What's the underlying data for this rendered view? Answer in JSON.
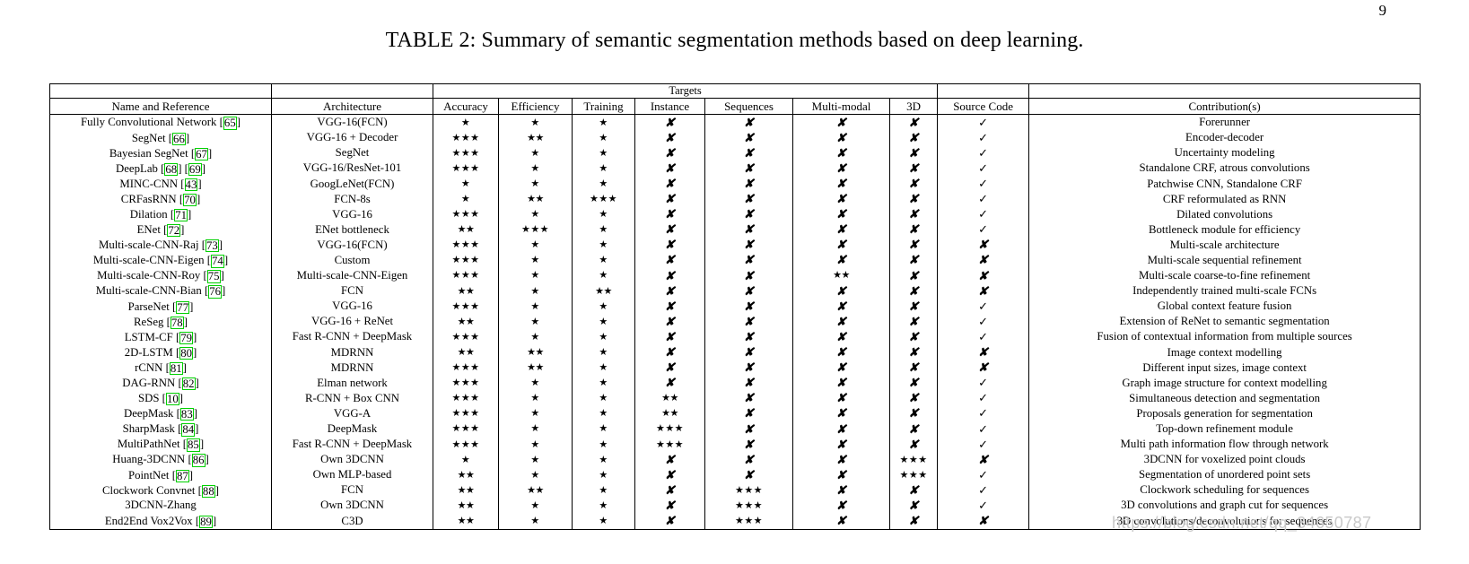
{
  "page": {
    "number": "9",
    "caption": "TABLE 2: Summary of semantic segmentation methods based on deep learning.",
    "watermark": "https://blog.csdn.net/qq_34650787"
  },
  "table": {
    "group_header": {
      "targets_label": "Targets"
    },
    "columns": [
      {
        "key": "name",
        "label": "Name and Reference"
      },
      {
        "key": "architecture",
        "label": "Architecture"
      },
      {
        "key": "accuracy",
        "label": "Accuracy"
      },
      {
        "key": "efficiency",
        "label": "Efficiency"
      },
      {
        "key": "training",
        "label": "Training"
      },
      {
        "key": "instance",
        "label": "Instance"
      },
      {
        "key": "sequences",
        "label": "Sequences"
      },
      {
        "key": "multimodal",
        "label": "Multi-modal"
      },
      {
        "key": "threed",
        "label": "3D"
      },
      {
        "key": "source_code",
        "label": "Source Code"
      },
      {
        "key": "contribution",
        "label": "Contribution(s)"
      }
    ],
    "marks": {
      "star": "★",
      "cross": "✘",
      "check": "✓",
      "ref_box_color": "#00d000"
    },
    "rows": [
      {
        "name": "Fully Convolutional Network",
        "refs": [
          "65"
        ],
        "architecture": "VGG-16(FCN)",
        "accuracy": 1,
        "efficiency": 1,
        "training": 1,
        "instance": "cross",
        "sequences": "cross",
        "multimodal": "cross",
        "threed": "cross",
        "source_code": "check",
        "contribution": "Forerunner"
      },
      {
        "name": "SegNet",
        "refs": [
          "66"
        ],
        "architecture": "VGG-16 + Decoder",
        "accuracy": 3,
        "efficiency": 2,
        "training": 1,
        "instance": "cross",
        "sequences": "cross",
        "multimodal": "cross",
        "threed": "cross",
        "source_code": "check",
        "contribution": "Encoder-decoder"
      },
      {
        "name": "Bayesian SegNet",
        "refs": [
          "67"
        ],
        "architecture": "SegNet",
        "accuracy": 3,
        "efficiency": 1,
        "training": 1,
        "instance": "cross",
        "sequences": "cross",
        "multimodal": "cross",
        "threed": "cross",
        "source_code": "check",
        "contribution": "Uncertainty modeling"
      },
      {
        "name": "DeepLab",
        "refs": [
          "68",
          "69"
        ],
        "architecture": "VGG-16/ResNet-101",
        "accuracy": 3,
        "efficiency": 1,
        "training": 1,
        "instance": "cross",
        "sequences": "cross",
        "multimodal": "cross",
        "threed": "cross",
        "source_code": "check",
        "contribution": "Standalone CRF, atrous convolutions"
      },
      {
        "name": "MINC-CNN",
        "refs": [
          "43"
        ],
        "architecture": "GoogLeNet(FCN)",
        "accuracy": 1,
        "efficiency": 1,
        "training": 1,
        "instance": "cross",
        "sequences": "cross",
        "multimodal": "cross",
        "threed": "cross",
        "source_code": "check",
        "contribution": "Patchwise CNN, Standalone CRF"
      },
      {
        "name": "CRFasRNN",
        "refs": [
          "70"
        ],
        "architecture": "FCN-8s",
        "accuracy": 1,
        "efficiency": 2,
        "training": 3,
        "instance": "cross",
        "sequences": "cross",
        "multimodal": "cross",
        "threed": "cross",
        "source_code": "check",
        "contribution": "CRF reformulated as RNN"
      },
      {
        "name": "Dilation",
        "refs": [
          "71"
        ],
        "architecture": "VGG-16",
        "accuracy": 3,
        "efficiency": 1,
        "training": 1,
        "instance": "cross",
        "sequences": "cross",
        "multimodal": "cross",
        "threed": "cross",
        "source_code": "check",
        "contribution": "Dilated convolutions"
      },
      {
        "name": "ENet",
        "refs": [
          "72"
        ],
        "architecture": "ENet bottleneck",
        "accuracy": 2,
        "efficiency": 3,
        "training": 1,
        "instance": "cross",
        "sequences": "cross",
        "multimodal": "cross",
        "threed": "cross",
        "source_code": "check",
        "contribution": "Bottleneck module for efficiency"
      },
      {
        "name": "Multi-scale-CNN-Raj",
        "refs": [
          "73"
        ],
        "architecture": "VGG-16(FCN)",
        "accuracy": 3,
        "efficiency": 1,
        "training": 1,
        "instance": "cross",
        "sequences": "cross",
        "multimodal": "cross",
        "threed": "cross",
        "source_code": "cross",
        "contribution": "Multi-scale architecture"
      },
      {
        "name": "Multi-scale-CNN-Eigen",
        "refs": [
          "74"
        ],
        "architecture": "Custom",
        "accuracy": 3,
        "efficiency": 1,
        "training": 1,
        "instance": "cross",
        "sequences": "cross",
        "multimodal": "cross",
        "threed": "cross",
        "source_code": "cross",
        "contribution": "Multi-scale sequential refinement"
      },
      {
        "name": "Multi-scale-CNN-Roy",
        "refs": [
          "75"
        ],
        "architecture": "Multi-scale-CNN-Eigen",
        "accuracy": 3,
        "efficiency": 1,
        "training": 1,
        "instance": "cross",
        "sequences": "cross",
        "multimodal": 2,
        "threed": "cross",
        "source_code": "cross",
        "contribution": "Multi-scale coarse-to-fine refinement"
      },
      {
        "name": "Multi-scale-CNN-Bian",
        "refs": [
          "76"
        ],
        "architecture": "FCN",
        "accuracy": 2,
        "efficiency": 1,
        "training": 2,
        "instance": "cross",
        "sequences": "cross",
        "multimodal": "cross",
        "threed": "cross",
        "source_code": "cross",
        "contribution": "Independently trained multi-scale FCNs"
      },
      {
        "name": "ParseNet",
        "refs": [
          "77"
        ],
        "architecture": "VGG-16",
        "accuracy": 3,
        "efficiency": 1,
        "training": 1,
        "instance": "cross",
        "sequences": "cross",
        "multimodal": "cross",
        "threed": "cross",
        "source_code": "check",
        "contribution": "Global context feature fusion"
      },
      {
        "name": "ReSeg",
        "refs": [
          "78"
        ],
        "architecture": "VGG-16 + ReNet",
        "accuracy": 2,
        "efficiency": 1,
        "training": 1,
        "instance": "cross",
        "sequences": "cross",
        "multimodal": "cross",
        "threed": "cross",
        "source_code": "check",
        "contribution": "Extension of ReNet to semantic segmentation"
      },
      {
        "name": "LSTM-CF",
        "refs": [
          "79"
        ],
        "architecture": "Fast R-CNN + DeepMask",
        "accuracy": 3,
        "efficiency": 1,
        "training": 1,
        "instance": "cross",
        "sequences": "cross",
        "multimodal": "cross",
        "threed": "cross",
        "source_code": "check",
        "contribution": "Fusion of contextual information from multiple sources"
      },
      {
        "name": "2D-LSTM",
        "refs": [
          "80"
        ],
        "architecture": "MDRNN",
        "accuracy": 2,
        "efficiency": 2,
        "training": 1,
        "instance": "cross",
        "sequences": "cross",
        "multimodal": "cross",
        "threed": "cross",
        "source_code": "cross",
        "contribution": "Image context modelling"
      },
      {
        "name": "rCNN",
        "refs": [
          "81"
        ],
        "architecture": "MDRNN",
        "accuracy": 3,
        "efficiency": 2,
        "training": 1,
        "instance": "cross",
        "sequences": "cross",
        "multimodal": "cross",
        "threed": "cross",
        "source_code": "cross",
        "contribution": "Different input sizes, image context"
      },
      {
        "name": "DAG-RNN",
        "refs": [
          "82"
        ],
        "architecture": "Elman network",
        "accuracy": 3,
        "efficiency": 1,
        "training": 1,
        "instance": "cross",
        "sequences": "cross",
        "multimodal": "cross",
        "threed": "cross",
        "source_code": "check",
        "contribution": "Graph image structure for context modelling"
      },
      {
        "name": "SDS",
        "refs": [
          "10"
        ],
        "architecture": "R-CNN + Box CNN",
        "accuracy": 3,
        "efficiency": 1,
        "training": 1,
        "instance": 2,
        "sequences": "cross",
        "multimodal": "cross",
        "threed": "cross",
        "source_code": "check",
        "contribution": "Simultaneous detection and segmentation"
      },
      {
        "name": "DeepMask",
        "refs": [
          "83"
        ],
        "architecture": "VGG-A",
        "accuracy": 3,
        "efficiency": 1,
        "training": 1,
        "instance": 2,
        "sequences": "cross",
        "multimodal": "cross",
        "threed": "cross",
        "source_code": "check",
        "contribution": "Proposals generation for segmentation"
      },
      {
        "name": "SharpMask",
        "refs": [
          "84"
        ],
        "architecture": "DeepMask",
        "accuracy": 3,
        "efficiency": 1,
        "training": 1,
        "instance": 3,
        "sequences": "cross",
        "multimodal": "cross",
        "threed": "cross",
        "source_code": "check",
        "contribution": "Top-down refinement module"
      },
      {
        "name": "MultiPathNet",
        "refs": [
          "85"
        ],
        "architecture": "Fast R-CNN + DeepMask",
        "accuracy": 3,
        "efficiency": 1,
        "training": 1,
        "instance": 3,
        "sequences": "cross",
        "multimodal": "cross",
        "threed": "cross",
        "source_code": "check",
        "contribution": "Multi path information flow through network"
      },
      {
        "name": "Huang-3DCNN",
        "refs": [
          "86"
        ],
        "architecture": "Own 3DCNN",
        "accuracy": 1,
        "efficiency": 1,
        "training": 1,
        "instance": "cross",
        "sequences": "cross",
        "multimodal": "cross",
        "threed": 3,
        "source_code": "cross",
        "contribution": "3DCNN for voxelized point clouds"
      },
      {
        "name": "PointNet",
        "refs": [
          "87"
        ],
        "architecture": "Own MLP-based",
        "accuracy": 2,
        "efficiency": 1,
        "training": 1,
        "instance": "cross",
        "sequences": "cross",
        "multimodal": "cross",
        "threed": 3,
        "source_code": "check",
        "contribution": "Segmentation of unordered point sets"
      },
      {
        "name": "Clockwork Convnet",
        "refs": [
          "88"
        ],
        "architecture": "FCN",
        "accuracy": 2,
        "efficiency": 2,
        "training": 1,
        "instance": "cross",
        "sequences": 3,
        "multimodal": "cross",
        "threed": "cross",
        "source_code": "check",
        "contribution": "Clockwork scheduling for sequences"
      },
      {
        "name": "3DCNN-Zhang",
        "refs": [],
        "architecture": "Own 3DCNN",
        "accuracy": 2,
        "efficiency": 1,
        "training": 1,
        "instance": "cross",
        "sequences": 3,
        "multimodal": "cross",
        "threed": "cross",
        "source_code": "check",
        "contribution": "3D convolutions and graph cut for sequences"
      },
      {
        "name": "End2End Vox2Vox",
        "refs": [
          "89"
        ],
        "architecture": "C3D",
        "accuracy": 2,
        "efficiency": 1,
        "training": 1,
        "instance": "cross",
        "sequences": 3,
        "multimodal": "cross",
        "threed": "cross",
        "source_code": "cross",
        "contribution": "3D convolutions/deconvolutions for sequences"
      }
    ]
  }
}
